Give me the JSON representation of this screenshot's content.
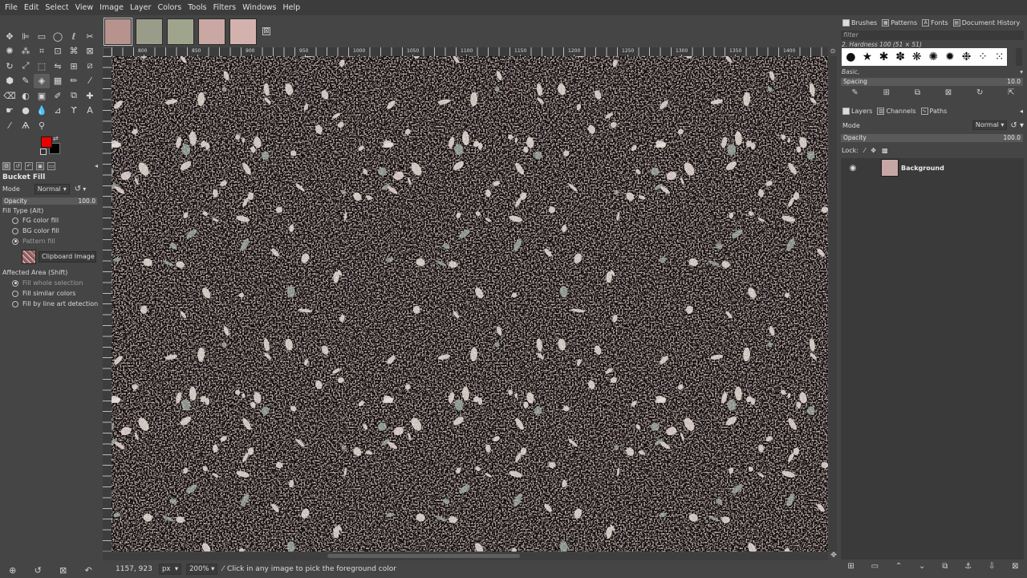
{
  "menubar": {
    "items": [
      "File",
      "Edit",
      "Select",
      "View",
      "Image",
      "Layer",
      "Colors",
      "Tools",
      "Filters",
      "Windows",
      "Help"
    ]
  },
  "image_tabs": {
    "thumbnails": [
      {
        "color": "#b8938e",
        "active": true
      },
      {
        "color": "#9a9c8a",
        "active": false
      },
      {
        "color": "#9fa48c",
        "active": false
      },
      {
        "color": "#c9a7a3",
        "active": false
      },
      {
        "color": "#d3b2ae",
        "active": false
      }
    ],
    "close_glyph": "⊠"
  },
  "toolbox": {
    "tools": [
      {
        "name": "move-tool-icon",
        "glyph": "✥"
      },
      {
        "name": "align-tool-icon",
        "glyph": "⊫"
      },
      {
        "name": "rect-select-icon",
        "glyph": "▭"
      },
      {
        "name": "ellipse-select-icon",
        "glyph": "◯"
      },
      {
        "name": "free-select-icon",
        "glyph": "ℓ"
      },
      {
        "name": "scissors-select-icon",
        "glyph": "✂"
      },
      {
        "name": "fuzzy-select-icon",
        "glyph": "✺"
      },
      {
        "name": "color-select-icon",
        "glyph": "⁂"
      },
      {
        "name": "crop-tool-icon",
        "glyph": "⌗"
      },
      {
        "name": "unified-transform-icon",
        "glyph": "⊡"
      },
      {
        "name": "warp-transform-icon",
        "glyph": "⌘"
      },
      {
        "name": "cage-transform-icon",
        "glyph": "⊠"
      },
      {
        "name": "rotate-tool-icon",
        "glyph": "↻"
      },
      {
        "name": "scale-tool-icon",
        "glyph": "⤢"
      },
      {
        "name": "perspective-tool-icon",
        "glyph": "⬚"
      },
      {
        "name": "flip-tool-icon",
        "glyph": "⇋"
      },
      {
        "name": "handle-transform-icon",
        "glyph": "⊞"
      },
      {
        "name": "shear-tool-icon",
        "glyph": "⧄"
      },
      {
        "name": "paint-select-icon",
        "glyph": "⬢"
      },
      {
        "name": "paths-tool-icon",
        "glyph": "✎"
      },
      {
        "name": "bucket-fill-icon",
        "glyph": "◈",
        "active": true
      },
      {
        "name": "gradient-tool-icon",
        "glyph": "▦"
      },
      {
        "name": "pencil-tool-icon",
        "glyph": "✏"
      },
      {
        "name": "paintbrush-tool-icon",
        "glyph": "⁄"
      },
      {
        "name": "eraser-tool-icon",
        "glyph": "⌫"
      },
      {
        "name": "airbrush-tool-icon",
        "glyph": "◐"
      },
      {
        "name": "ink-tool-icon",
        "glyph": "▣"
      },
      {
        "name": "mypaint-brush-icon",
        "glyph": "✐"
      },
      {
        "name": "clone-tool-icon",
        "glyph": "⧉"
      },
      {
        "name": "heal-tool-icon",
        "glyph": "✚"
      },
      {
        "name": "smudge-tool-icon",
        "glyph": "☛"
      },
      {
        "name": "dodge-burn-icon",
        "glyph": "●"
      },
      {
        "name": "blur-sharpen-icon",
        "glyph": "💧"
      },
      {
        "name": "measure-tool-icon",
        "glyph": "⊿"
      },
      {
        "name": "warp-paint-icon",
        "glyph": "ϒ"
      },
      {
        "name": "text-tool-icon",
        "glyph": "A"
      },
      {
        "name": "color-picker-icon",
        "glyph": "⁄"
      },
      {
        "name": "foreground-select-icon",
        "glyph": "Ѧ"
      },
      {
        "name": "zoom-tool-icon",
        "glyph": "⚲"
      }
    ],
    "fg_color": "#ee0000",
    "bg_color": "#000000"
  },
  "tool_options": {
    "title": "Bucket Fill",
    "mode_label": "Mode",
    "mode_value": "Normal",
    "opacity_label": "Opacity",
    "opacity_value": "100.0",
    "fill_type_label": "Fill Type  (Alt)",
    "fill_options": [
      {
        "label": "FG color fill",
        "selected": false
      },
      {
        "label": "BG color fill",
        "selected": false
      },
      {
        "label": "Pattern fill",
        "selected": true
      }
    ],
    "pattern_name": "Clipboard Image",
    "affected_area_label": "Affected Area  (Shift)",
    "area_options": [
      {
        "label": "Fill whole selection",
        "selected": true
      },
      {
        "label": "Fill similar colors",
        "selected": false
      },
      {
        "label": "Fill by line art detection",
        "selected": false
      }
    ]
  },
  "ruler": {
    "h_labels": [
      "800",
      "850",
      "900",
      "950",
      "1000",
      "1050",
      "1100",
      "1150",
      "1200",
      "1250",
      "1300",
      "1350",
      "1400"
    ]
  },
  "statusbar": {
    "coords": "1157, 923",
    "unit": "px",
    "zoom": "200%",
    "message": "Click in any image to pick the foreground color"
  },
  "brushes_dock": {
    "tabs": [
      "Brushes",
      "Patterns",
      "Fonts",
      "Document History"
    ],
    "filter_placeholder": "filter",
    "brush_name": "2. Hardness 100 (51 × 51)",
    "brush_glyphs": [
      "●",
      "★",
      "✱",
      "✽",
      "❋",
      "✺",
      "✹",
      "❉",
      "⁘",
      "⁙"
    ],
    "tag": "Basic,",
    "spacing_label": "Spacing",
    "spacing_value": "10.0"
  },
  "layers_dock": {
    "tabs": [
      "Layers",
      "Channels",
      "Paths"
    ],
    "mode_label": "Mode",
    "mode_value": "Normal",
    "opacity_label": "Opacity",
    "opacity_value": "100.0",
    "lock_label": "Lock:",
    "layers": [
      {
        "name": "Background",
        "visible": true,
        "thumb_color": "#c7a7a5"
      }
    ]
  },
  "colors": {
    "texture_base": "#9c5a5c",
    "texture_light": "#e8dcd6",
    "texture_grey": "#a9b7b0"
  }
}
